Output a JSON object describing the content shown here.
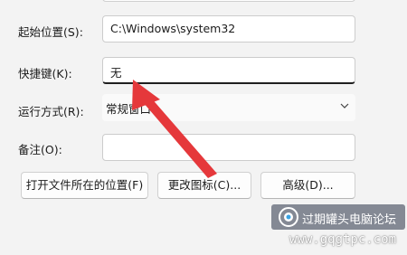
{
  "form": {
    "start_in_label": "起始位置(S):",
    "start_in_value": "C:\\Windows\\system32",
    "shortcut_key_label": "快捷键(K):",
    "shortcut_key_value": "无",
    "run_label": "运行方式(R):",
    "run_value": "常规窗口",
    "comment_label": "备注(O):",
    "comment_value": ""
  },
  "buttons": {
    "open_location": "打开文件所在的位置(F)",
    "change_icon": "更改图标(C)...",
    "advanced": "高级(D)..."
  },
  "watermark": {
    "name": "过期罐头电脑论坛",
    "url": "www.gqgtpc.com"
  },
  "colors": {
    "annotation_arrow": "#e5383b",
    "background": "#f3f3f3"
  }
}
